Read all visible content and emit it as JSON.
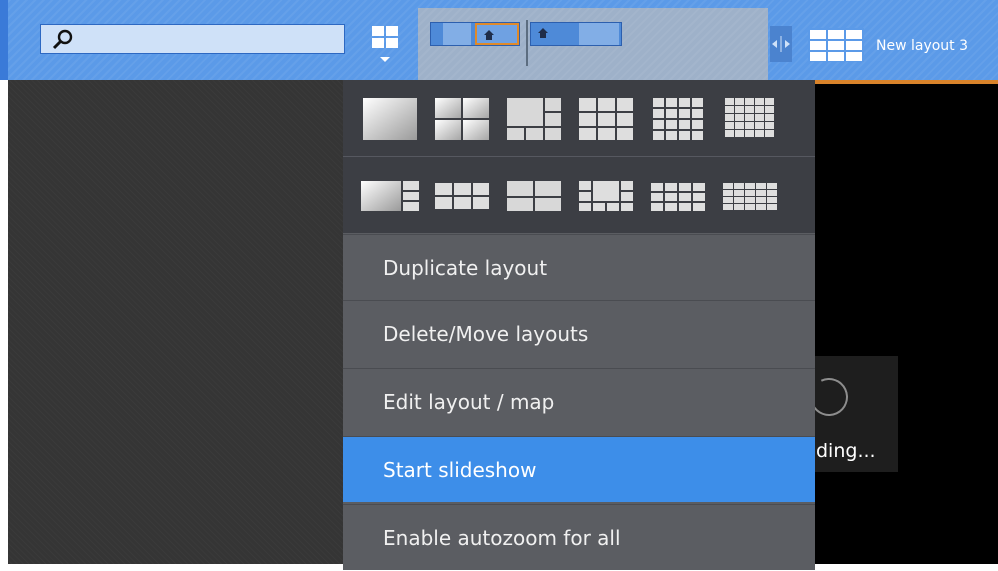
{
  "search": {
    "placeholder": "",
    "value": ""
  },
  "header": {
    "layouts_button_icon": "layout-grid-icon",
    "tab_title": "New layout 3",
    "home_icon": "home-icon",
    "split_icon": "split-arrows-icon"
  },
  "menu": {
    "grid_rows": [
      [
        "1x1",
        "2x2",
        "1+5",
        "3x3",
        "4x4",
        "5x5"
      ],
      [
        "1+3",
        "3x2",
        "2x2 wide",
        "1+7",
        "4x3",
        "5x4"
      ]
    ],
    "items": [
      {
        "label": "Duplicate layout"
      },
      {
        "label": "Delete/Move layouts"
      },
      {
        "label": "Edit layout / map"
      },
      {
        "label": "Start slideshow"
      },
      {
        "label": "Enable autozoom for all"
      }
    ],
    "active_index": 3
  },
  "viewer": {
    "loading_text": "ding..."
  },
  "colors": {
    "topbar": "#5b9ae8",
    "menu_bg": "#5b5d62",
    "menu_grid_bg": "#3c3e44",
    "highlight": "#3d8ee9",
    "accent_orange": "#d9832a"
  }
}
